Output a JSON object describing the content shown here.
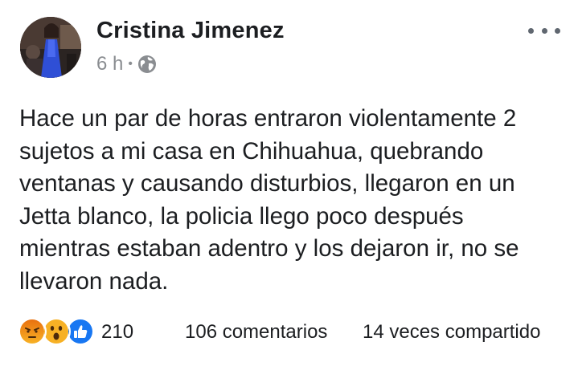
{
  "post": {
    "author": "Cristina Jimenez",
    "time": "6 h",
    "separator": "•",
    "privacy_icon": "globe-icon",
    "more_icon": "more-options-icon",
    "text_lines": [
      "Hace un par de horas entraron violentamente 2",
      "sujetos a mi casa en Chihuahua, quebrando",
      "ventanas y causando disturbios, llegaron en un",
      "Jetta blanco, la policia llego poco después",
      "mientras estaban adentro y los dejaron ir, no se",
      "llevaron nada."
    ]
  },
  "footer": {
    "reactions": [
      "angry-reaction-icon",
      "wow-reaction-icon",
      "like-reaction-icon"
    ],
    "reaction_count": "210",
    "comments": "106 comentarios",
    "shares": "14 veces compartido"
  },
  "colors": {
    "text": "#1c1e21",
    "meta": "#8a8d91",
    "like_blue": "#1877f2",
    "reaction_yellow": "#f7b125",
    "angry_red": "#e9710f"
  }
}
